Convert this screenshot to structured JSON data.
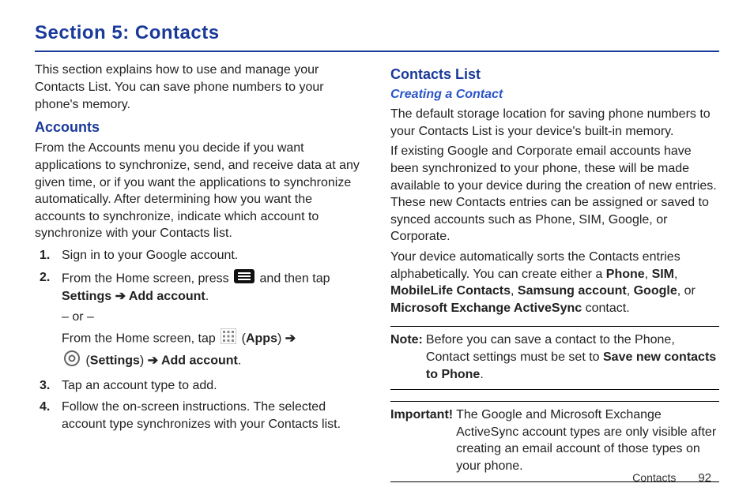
{
  "title": "Section 5: Contacts",
  "intro": "This section explains how to use and manage your Contacts List. You can save phone numbers to your phone's memory.",
  "left": {
    "accounts_heading": "Accounts",
    "accounts_para": "From the Accounts menu you decide if you want applications to synchronize, send, and receive data at any given time, or if you want the applications to synchronize automatically. After determining how you want the accounts to synchronize, indicate which account to synchronize with your Contacts list.",
    "step1": "Sign in to your Google account.",
    "step2_a": "From the Home screen, press ",
    "step2_b": " and then tap ",
    "step2_c_settings": "Settings",
    "step2_arrow": " ➔ ",
    "step2_c_add": "Add account",
    "step2_or": "– or –",
    "step2_d": "From the Home screen, tap ",
    "step2_apps": "Apps",
    "step2_settings2": "Settings",
    "step2_add2": "Add account",
    "step3": "Tap an account type to add.",
    "step4": "Follow the on-screen instructions. The selected account type synchronizes with your Contacts list."
  },
  "right": {
    "contacts_list_heading": "Contacts List",
    "creating_heading": "Creating a Contact",
    "p1": "The default storage location for saving phone numbers to your Contacts List is your device's built-in memory.",
    "p2": "If existing Google and Corporate email accounts have been synchronized to your phone, these will be made available to your device during the creation of new entries. These new Contacts entries can be assigned or saved to synced accounts such as Phone, SIM, Google, or Corporate.",
    "p3_a": "Your device automatically sorts the Contacts entries alphabetically. You can create either a ",
    "p3_phone": "Phone",
    "p3_sim": "SIM",
    "p3_mobilelife": "MobileLife Contacts",
    "p3_samsung": "Samsung account",
    "p3_google": "Google",
    "p3_or": ", or ",
    "p3_mseas": "Microsoft Exchange ActiveSync",
    "p3_end": " contact.",
    "note_label": "Note:",
    "note_body_a": "Before you can save a contact to the Phone, Contact settings must be set to ",
    "note_body_b": "Save new contacts to Phone",
    "important_label": "Important!",
    "important_body": "The Google and Microsoft Exchange ActiveSync account types are only visible after creating an email account of those types on your phone."
  },
  "footer": {
    "section": "Contacts",
    "page": "92"
  }
}
